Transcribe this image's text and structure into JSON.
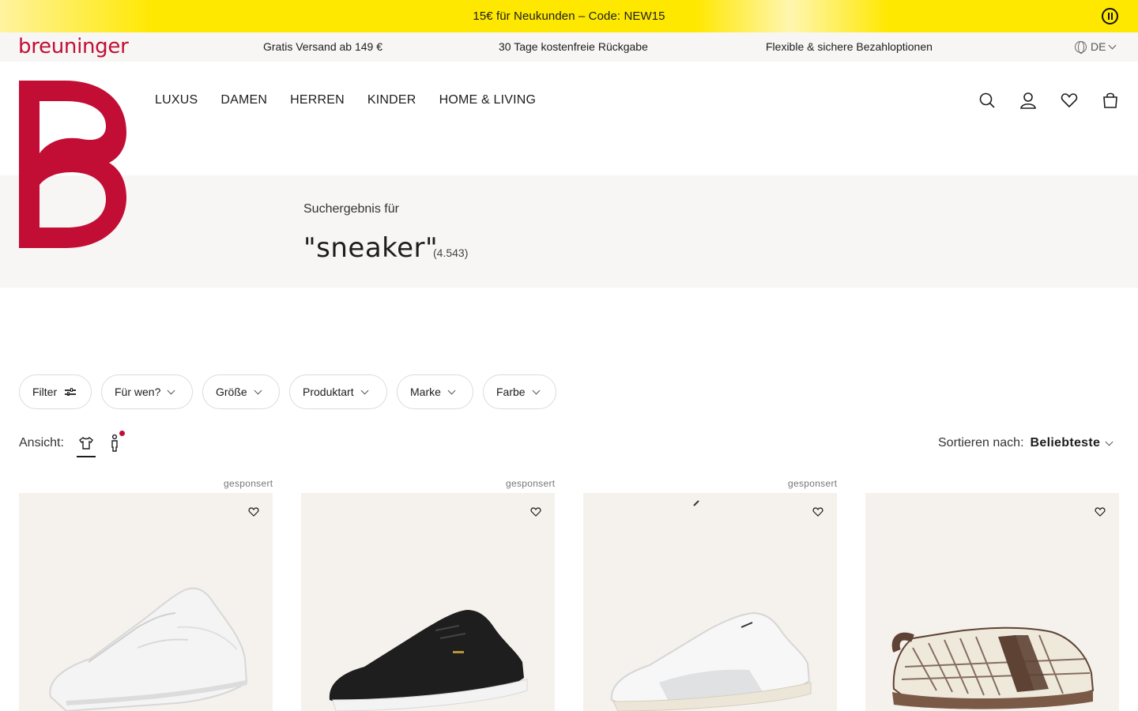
{
  "promo": {
    "text": "15€ für Neukunden – Code: NEW15"
  },
  "service": {
    "brand": "breuninger",
    "usps": [
      "Gratis Versand ab 149 €",
      "30 Tage kostenfreie Rückgabe",
      "Flexible & sichere Bezahloptionen"
    ],
    "language": "DE"
  },
  "nav": {
    "items": [
      "LUXUS",
      "DAMEN",
      "HERREN",
      "KINDER",
      "HOME & LIVING"
    ]
  },
  "header_icons": [
    "search-icon",
    "account-icon",
    "wishlist-icon",
    "cart-icon"
  ],
  "search": {
    "subtitle": "Suchergebnis für",
    "query": "\"sneaker\"",
    "count": "(4.543)"
  },
  "filters": {
    "items": [
      {
        "label": "Filter"
      },
      {
        "label": "Für wen?"
      },
      {
        "label": "Größe"
      },
      {
        "label": "Produktart"
      },
      {
        "label": "Marke"
      },
      {
        "label": "Farbe"
      }
    ]
  },
  "view": {
    "label": "Ansicht:"
  },
  "sort": {
    "label": "Sortieren nach:",
    "value": "Beliebteste"
  },
  "products": [
    {
      "sponsored": "gesponsert",
      "color": "white"
    },
    {
      "sponsored": "gesponsert",
      "color": "black"
    },
    {
      "sponsored": "gesponsert",
      "color": "white/grey"
    },
    {
      "sponsored": "",
      "color": "brown/cream"
    }
  ],
  "colors": {
    "brand_red": "#c20e35",
    "promo_yellow": "#ffe800",
    "band_bg": "#f7f6f4"
  }
}
